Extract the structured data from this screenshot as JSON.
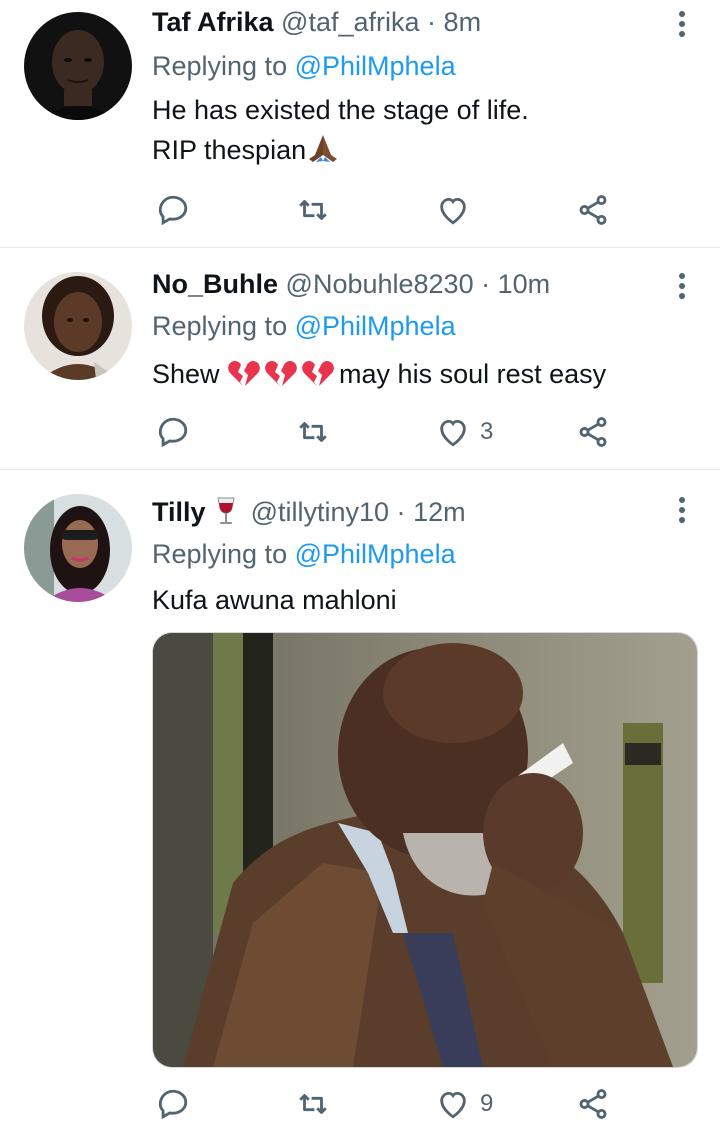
{
  "tweets": [
    {
      "name": "Taf Afrika",
      "handle": "@taf_afrika",
      "separator": "·",
      "time": "8m",
      "replying_prefix": "Replying to ",
      "replying_to": "@PhilMphela",
      "text_line1": "He has existed the stage of life.",
      "text_line2": "RIP thespian",
      "emoji_name": "folded-hands-emoji",
      "likes": ""
    },
    {
      "name": "No_Buhle",
      "handle": "@Nobuhle8230",
      "separator": "·",
      "time": "10m",
      "replying_prefix": "Replying to ",
      "replying_to": "@PhilMphela",
      "text_prefix": "Shew ",
      "text_suffix": "may his soul rest easy",
      "emoji_name": "broken-heart-emoji",
      "likes": "3"
    },
    {
      "name": "Tilly",
      "name_emoji": "wine-glass-emoji",
      "handle": "@tillytiny10",
      "separator": "·",
      "time": "12m",
      "replying_prefix": "Replying to ",
      "replying_to": "@PhilMphela",
      "text": "Kufa awuna mahloni",
      "media_name": "photo-man-wiping-tears",
      "likes": "9"
    }
  ],
  "icons": {
    "reply": "reply-icon",
    "retweet": "retweet-icon",
    "like": "like-icon",
    "share": "share-icon",
    "more": "more-vertical-icon"
  },
  "colors": {
    "text": "#0f1419",
    "secondary": "#536471",
    "link": "#1d9bf0",
    "divider": "#e6ecf0",
    "broken_heart": "#e8344c"
  }
}
